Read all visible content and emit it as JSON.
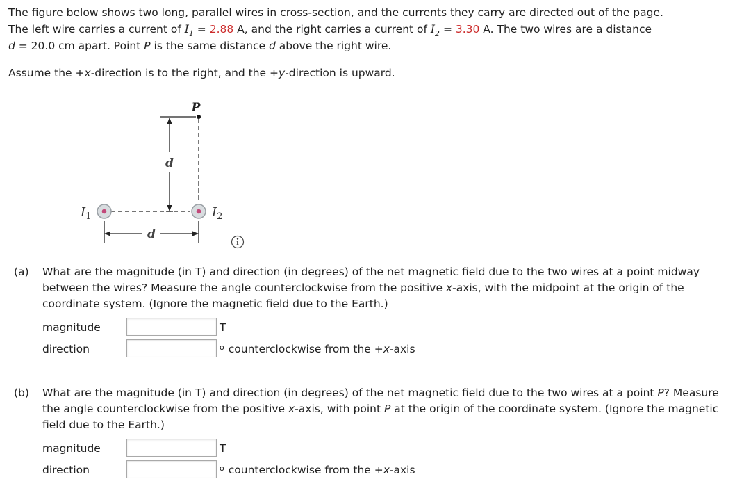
{
  "intro": {
    "line1": "The figure below shows two long, parallel wires in cross-section, and the currents they carry are directed out of the page.",
    "line2_a": "The left wire carries a current of ",
    "I1_symbol": "I",
    "I1_sub": "1",
    "eq": " = ",
    "I1_value": "2.88",
    "line2_b": " A, and the right carries a current of ",
    "I2_symbol": "I",
    "I2_sub": "2",
    "I2_value": "3.30",
    "line2_c": " A. The two wires are a distance",
    "d_symbol": "d",
    "line3_a": " = 20.0 cm apart. Point ",
    "P_symbol": "P",
    "line3_b": " is the same distance ",
    "line3_c": " above the right wire.",
    "assume_a": "Assume the +",
    "x": "x",
    "assume_b": "-direction is to the right, and the +",
    "y": "y",
    "assume_c": "-direction is upward."
  },
  "figure": {
    "label_P": "P",
    "label_d_vertical": "d",
    "label_d_horizontal": "d",
    "label_I": "I",
    "label_I1_sub": "1",
    "label_I2_sub": "2",
    "colors": {
      "wire_fill": "#d8dcdf",
      "wire_stroke": "#9aa0a5",
      "dot": "#c2497a"
    }
  },
  "info_icon": "info-icon",
  "parts": [
    {
      "letter": "(a)",
      "question_a": "What are the magnitude (in T) and direction (in degrees) of the net magnetic field due to the two wires at a point midway between the wires? Measure the angle counterclockwise from the positive ",
      "x": "x",
      "question_b": "-axis, with the midpoint at the origin of the coordinate system. (Ignore the magnetic field due to the Earth.)",
      "magnitude_label": "magnitude",
      "magnitude_value": "",
      "magnitude_unit": "T",
      "direction_label": "direction",
      "direction_value": "",
      "degree_symbol": "o",
      "direction_unit_a": "counterclockwise from the +",
      "direction_unit_x": "x",
      "direction_unit_b": "-axis"
    },
    {
      "letter": "(b)",
      "question_a": "What are the magnitude (in T) and direction (in degrees) of the net magnetic field due to the two wires at a point ",
      "P": "P",
      "question_b": "? Measure the angle counterclockwise from the positive ",
      "x": "x",
      "question_c": "-axis, with point ",
      "question_d": " at the origin of the coordinate system. (Ignore the magnetic field due to the Earth.)",
      "magnitude_label": "magnitude",
      "magnitude_value": "",
      "magnitude_unit": "T",
      "direction_label": "direction",
      "direction_value": "",
      "degree_symbol": "o",
      "direction_unit_a": "counterclockwise from the +",
      "direction_unit_x": "x",
      "direction_unit_b": "-axis"
    }
  ]
}
